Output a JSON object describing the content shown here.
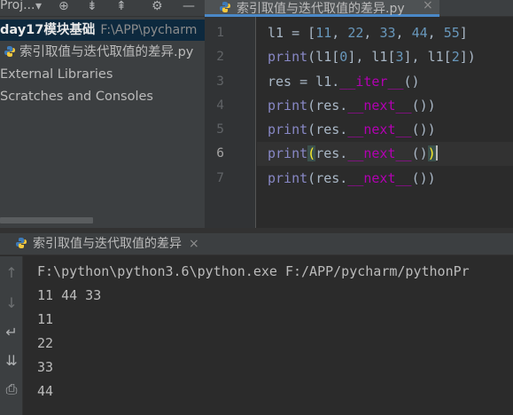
{
  "project_panel": {
    "title": "Proj...",
    "toolbar_icons": [
      "dropdown-arrow",
      "target-icon",
      "collapse-all-icon",
      "expand-all-icon",
      "gear-icon",
      "minimize-icon"
    ],
    "tree": [
      {
        "name": "day17模块基础",
        "path": "F:\\APP\\pycharm"
      },
      {
        "name": "索引取值与迭代取值的差异.py"
      },
      {
        "name": "External Libraries"
      },
      {
        "name": "Scratches and Consoles"
      }
    ]
  },
  "editor": {
    "tab_label": "索引取值与迭代取值的差异.py",
    "tab_close": "×",
    "line_numbers": [
      "1",
      "2",
      "3",
      "4",
      "5",
      "6",
      "7"
    ],
    "current_line": 6,
    "code": {
      "l1_assign": "l1 = [",
      "n11": "11",
      "n22": "22",
      "n33": "33",
      "n44": "44",
      "n55": "55",
      "sep": ", ",
      "close_bracket": "]",
      "print_kw": "print",
      "l1_idx_open": "(l1[",
      "idx0": "0",
      "mid1": "], l1[",
      "idx3": "3",
      "idx2": "2",
      "idx_close": "])",
      "res_assign": "res = l1.",
      "iter": "__iter__",
      "call": "()",
      "open_paren": "(",
      "close_paren": ")",
      "res_dot": "res.",
      "next": "__next__",
      "call_close": "())"
    }
  },
  "run_panel": {
    "tab_label": "索引取值与迭代取值的差异",
    "tab_close": "×",
    "console_lines": [
      "F:\\python\\python3.6\\python.exe F:/APP/pycharm/pythonPr",
      "11 44 33",
      "11",
      "22",
      "33",
      "44"
    ]
  }
}
